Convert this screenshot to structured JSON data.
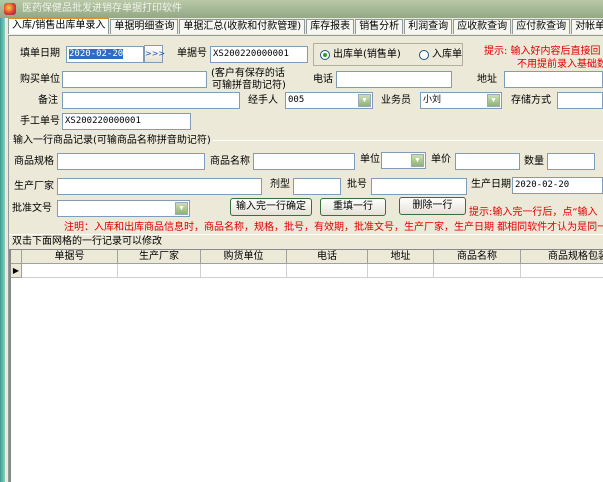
{
  "window": {
    "title": "医药保健品批发进销存单据打印软件"
  },
  "tabs": [
    "入库/销售出库单录入",
    "单据明细查询",
    "单据汇总(收款和付款管理)",
    "库存报表",
    "销售分析",
    "利润查询",
    "应收款查询",
    "应付款查询",
    "对帐单"
  ],
  "header": {
    "date_label": "填单日期",
    "date_value": "2020-02-20",
    "date_btn": ">>>",
    "doc_no_label": "单据号",
    "doc_no_value": "XS200220000001",
    "radio_out": "出库单(销售单)",
    "radio_in": "入库单",
    "hint_line1": "提示: 输入好内容后直接回",
    "hint_line2": "不用提前录入基础数",
    "buyer_label": "购买单位",
    "buyer_value": "",
    "buyer_note1": "(客户有保存的话",
    "buyer_note2": "可输拼音助记符)",
    "phone_label": "电话",
    "phone_value": "",
    "address_label": "地址",
    "address_value": "",
    "remark_label": "备注",
    "remark_value": "",
    "handler_label": "经手人",
    "handler_value": "005",
    "sales_label": "业务员",
    "sales_value": "小刘",
    "storage_label": "存储方式",
    "storage_value": "",
    "manual_no_label": "手工单号",
    "manual_no_value": "XS200220000001"
  },
  "item": {
    "group_title": "输入一行商品记录(可输商品名称拼音助记符)",
    "spec_label": "商品规格",
    "name_label": "商品名称",
    "unit_label": "单位",
    "price_label": "单价",
    "qty_label": "数量",
    "maker_label": "生产厂家",
    "form_label": "剂型",
    "batch_label": "批号",
    "prod_date_label": "生产日期",
    "prod_date_value": "2020-02-20",
    "approval_label": "批准文号",
    "confirm_btn": "输入完一行确定",
    "reset_btn": "重填一行",
    "delete_btn": "删除一行",
    "hint": "提示:输入完一行后，点“输入",
    "note": "注明：入库和出库商品信息时，商品名称，规格，批号，有效期，批准文号，生产厂家，生产日期  都相同软件才认为是同一"
  },
  "grid": {
    "title": "双击下面网格的一行记录可以修改",
    "columns": [
      "单据号",
      "生产厂家",
      "购货单位",
      "电话",
      "地址",
      "商品名称",
      "商品规格包装"
    ]
  }
}
